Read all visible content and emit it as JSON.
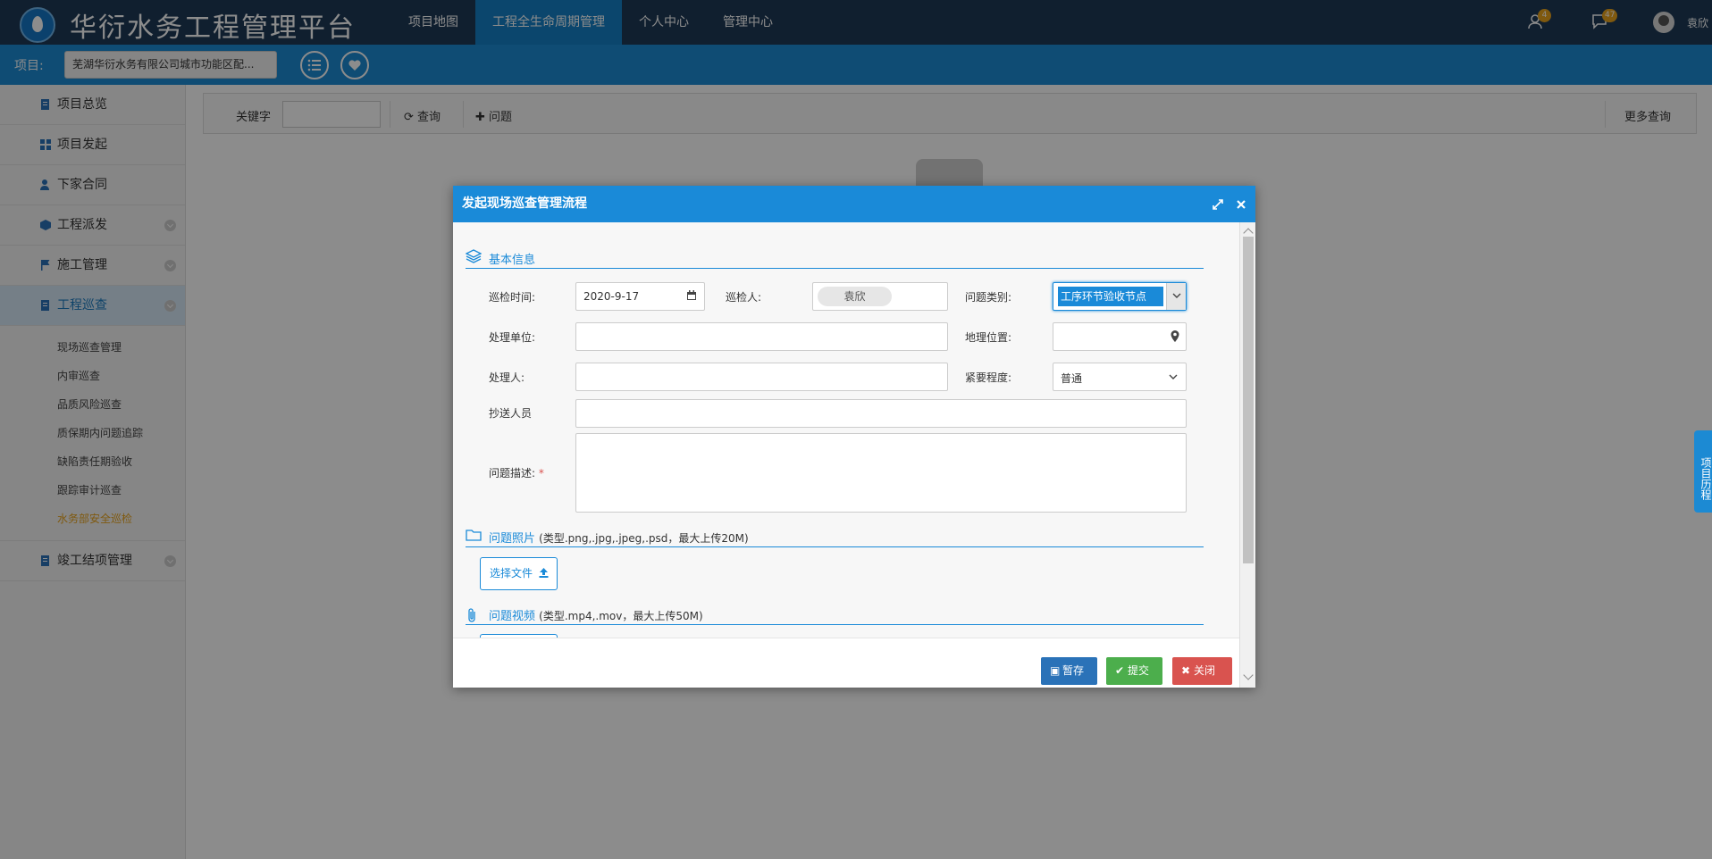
{
  "app": {
    "title": "华衍水务工程管理平台",
    "nav": [
      "项目地图",
      "工程全生命周期管理",
      "个人中心",
      "管理中心"
    ],
    "notifications": {
      "user_badge": "4",
      "message_badge": "47"
    },
    "user_name": "袁欣"
  },
  "project_bar": {
    "label": "项目:",
    "value": "芜湖华衍水务有限公司城市功能区配..."
  },
  "sidebar": {
    "items": [
      {
        "label": "项目总览"
      },
      {
        "label": "项目发起"
      },
      {
        "label": "下家合同"
      },
      {
        "label": "工程派发"
      },
      {
        "label": "施工管理"
      },
      {
        "label": "工程巡查"
      }
    ],
    "sub_items": [
      "现场巡查管理",
      "内审巡查",
      "品质风险巡查",
      "质保期内问题追踪",
      "缺陷责任期验收",
      "跟踪审计巡查",
      "水务部安全巡检"
    ],
    "last_item": {
      "label": "竣工结项管理"
    }
  },
  "searchbar": {
    "keyword_label": "关键字",
    "query_label": "查询",
    "issue_label": "问题",
    "more_label": "更多查询"
  },
  "right_tab": {
    "label": "项目历程"
  },
  "modal": {
    "title": "发起现场巡查管理流程",
    "section_basic": "基本信息",
    "fields": {
      "inspect_time_label": "巡检时间:",
      "inspect_time_value": "2020-9-17",
      "inspector_label": "巡检人:",
      "inspector_value": "袁欣",
      "issue_type_label": "问题类别:",
      "issue_type_value": "工序环节验收节点",
      "handling_unit_label": "处理单位:",
      "location_label": "地理位置:",
      "handler_label": "处理人:",
      "urgency_label": "紧要程度:",
      "urgency_value": "普通",
      "cc_label": "抄送人员",
      "desc_label": "问题描述:",
      "required_mark": "*"
    },
    "section_photo": "问题照片",
    "photo_hint": "(类型.png,.jpg,.jpeg,.psd，最大上传20M)",
    "upload_label": "选择文件",
    "section_video": "问题视频",
    "video_hint": "(类型.mp4,.mov，最大上传50M)",
    "buttons": {
      "save": "暂存",
      "submit": "提交",
      "close": "关闭"
    },
    "colors": {
      "save": "#2a72b8",
      "submit": "#4cae4c",
      "close": "#d9534f"
    }
  }
}
